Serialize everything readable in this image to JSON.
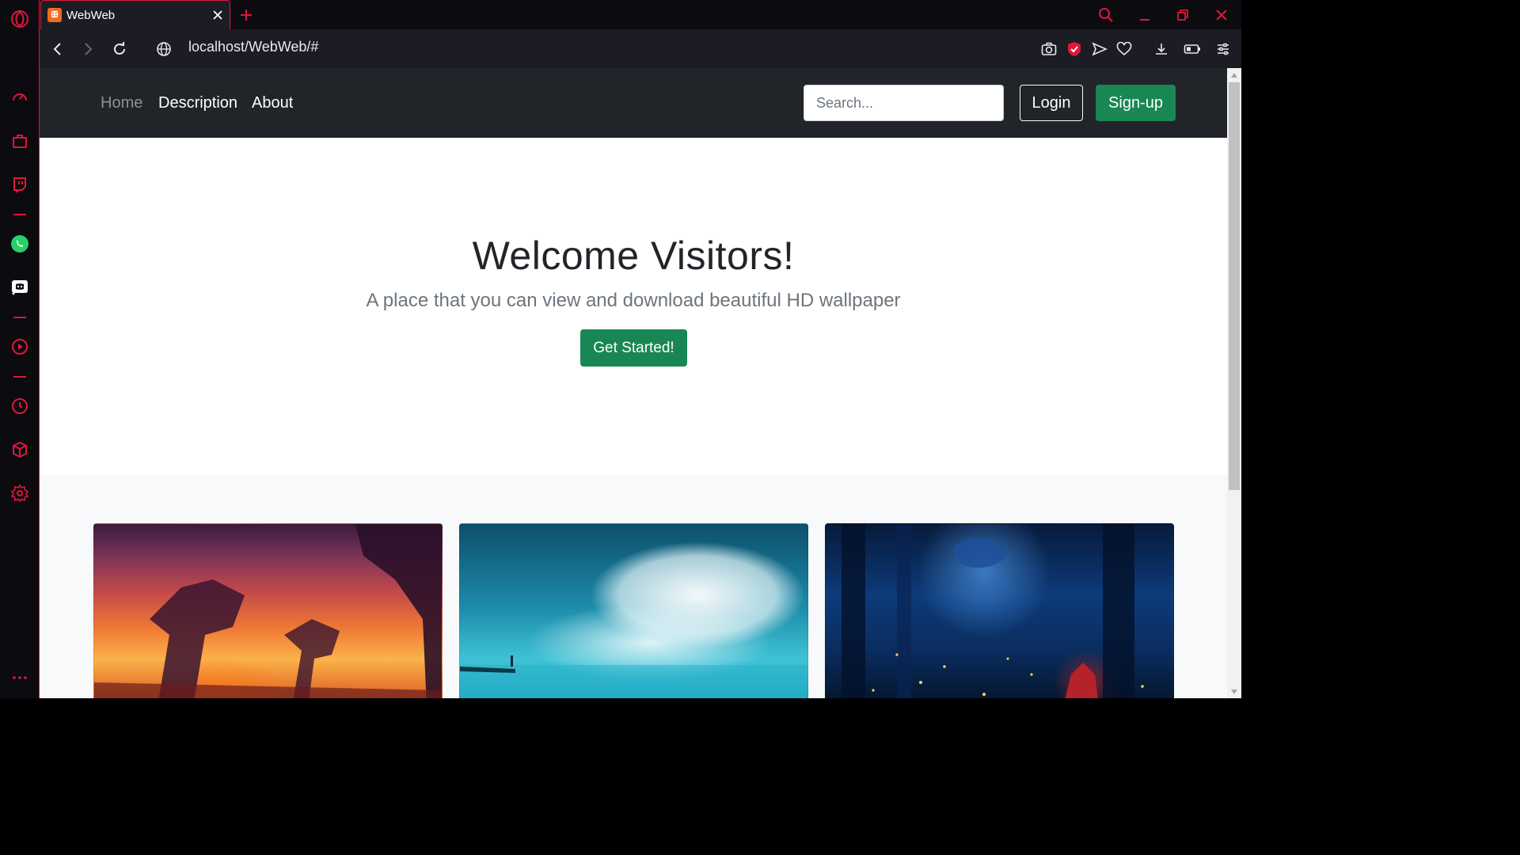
{
  "browser": {
    "tab_title": "WebWeb",
    "favicon_glyph": "ꕥ",
    "url": "localhost/WebWeb/#",
    "accent_color": "#e0163b"
  },
  "sidebar": {
    "items": [
      {
        "icon": "opera-logo-icon"
      },
      {
        "icon": "speed-dial-icon"
      },
      {
        "icon": "briefcase-icon"
      },
      {
        "icon": "twitch-icon"
      },
      {
        "icon": "whatsapp-icon"
      },
      {
        "icon": "discord-icon"
      },
      {
        "icon": "player-icon"
      },
      {
        "icon": "history-icon"
      },
      {
        "icon": "box-icon"
      },
      {
        "icon": "settings-icon"
      },
      {
        "icon": "more-icon"
      }
    ]
  },
  "navbar": {
    "links": [
      "Home",
      "Description",
      "About"
    ],
    "search_placeholder": "Search...",
    "login_label": "Login",
    "signup_label": "Sign-up"
  },
  "hero": {
    "title": "Welcome Visitors!",
    "subtitle": "A place that you can view and download beautiful HD wallpaper",
    "cta_label": "Get Started!"
  },
  "colors": {
    "navbar_bg": "#212529",
    "success": "#198754"
  }
}
